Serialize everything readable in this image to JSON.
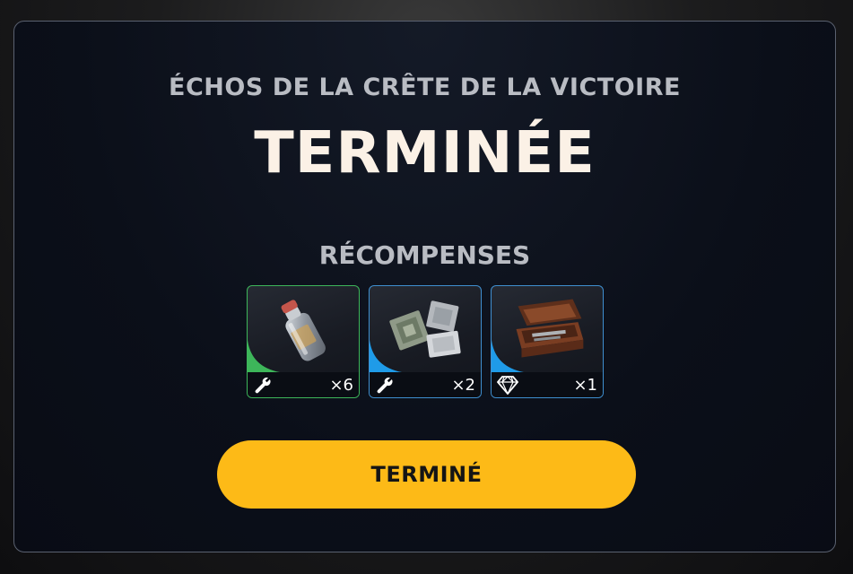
{
  "dialog": {
    "subtitle": "ÉCHOS DE LA CRÊTE DE LA VICTOIRE",
    "title": "TERMINÉE",
    "rewards_label": "RÉCOMPENSES",
    "button_label": "TERMINÉ"
  },
  "rewards": [
    {
      "item_icon": "bottle-icon",
      "category_icon": "wrench-icon",
      "quantity": "×6",
      "rarity_color": "#3db65a"
    },
    {
      "item_icon": "circuit-boards-icon",
      "category_icon": "wrench-icon",
      "quantity": "×2",
      "rarity_color": "#1f9be8"
    },
    {
      "item_icon": "wooden-case-icon",
      "category_icon": "diamond-icon",
      "quantity": "×1",
      "rarity_color": "#1f9be8"
    }
  ],
  "colors": {
    "accent": "#fdba17",
    "title_text": "#fbf1e6",
    "muted_text": "#b9bcc3",
    "panel_bg": "#0b0f19",
    "panel_border": "#5a6170"
  }
}
